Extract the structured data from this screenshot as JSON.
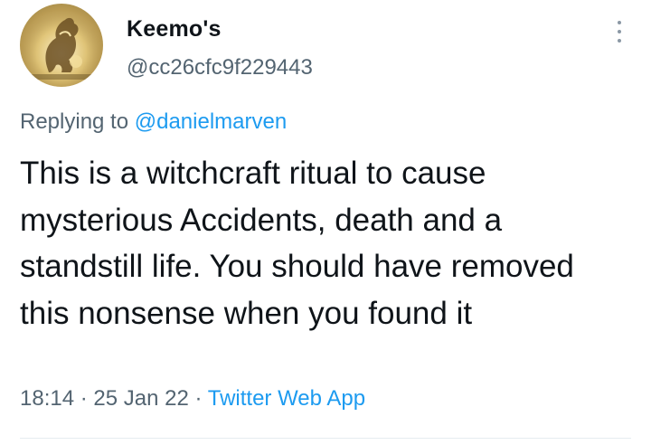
{
  "user": {
    "display_name": "Keemo's",
    "handle": "@cc26cfc9f229443"
  },
  "reply": {
    "prefix": "Replying to",
    "mention": "@danielmarven"
  },
  "tweet": {
    "text": "This is a witchcraft ritual to cause mysterious Accidents, death and a standstill life. You should have removed this nonsense when you found it"
  },
  "meta": {
    "time": "18:14",
    "separator": "·",
    "date": "25 Jan 22",
    "app": "Twitter Web App"
  },
  "icons": {
    "more": "more-vertical-icon",
    "avatar": "golden-horse-emblem"
  },
  "colors": {
    "link": "#1d9bf0",
    "secondary_text": "#536471",
    "primary_text": "#0f1419"
  }
}
